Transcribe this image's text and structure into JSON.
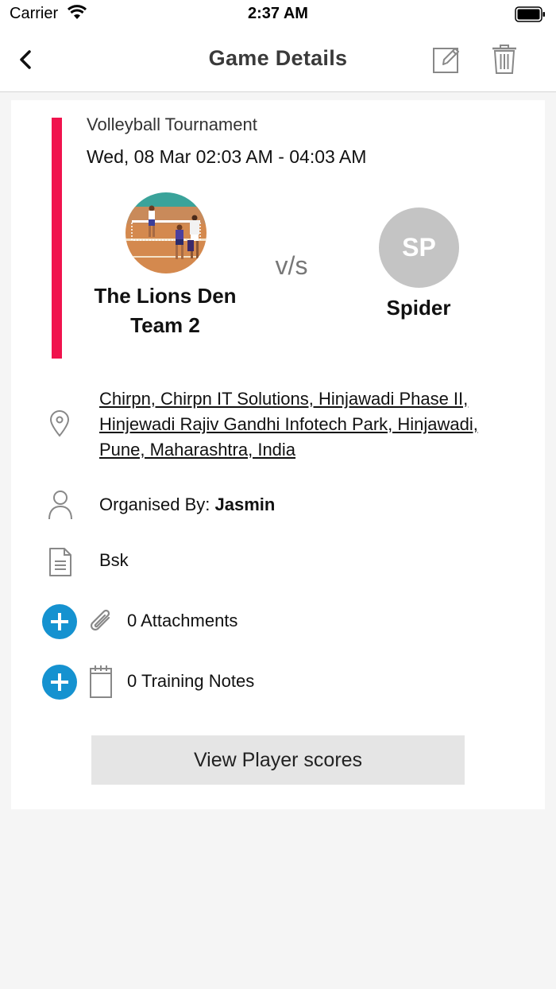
{
  "status_bar": {
    "carrier": "Carrier",
    "time": "2:37 AM"
  },
  "nav": {
    "title": "Game Details",
    "back_icon": "chevron-left-icon",
    "edit_icon": "edit-icon",
    "delete_icon": "trash-icon"
  },
  "game": {
    "title": "Volleyball Tournament",
    "datetime": "Wed, 08 Mar 02:03 AM - 04:03 AM",
    "vs": "v/s",
    "accent_color": "#f0134d",
    "team1": {
      "name_line1": "The Lions Den",
      "name_line2": "Team 2"
    },
    "team2": {
      "initials": "SP",
      "name": "Spider"
    }
  },
  "details": {
    "location_line1": "Chirpn, Chirpn IT Solutions, Hinjawadi Phase II,",
    "location_line2": "Hinjewadi Rajiv Gandhi Infotech Park, Hinjawadi,",
    "location_line3": "Pune, Maharashtra, India",
    "organiser_label": "Organised By: ",
    "organiser_name": "Jasmin",
    "description": "Bsk",
    "attachments": "0 Attachments",
    "training_notes": "0 Training Notes"
  },
  "actions": {
    "view_scores": "View Player scores",
    "add_color": "#1592d0"
  }
}
